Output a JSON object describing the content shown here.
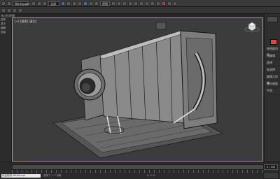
{
  "toolbar": {
    "workspace": "Workspace",
    "selection_filter": "全部",
    "view_select": "视图"
  },
  "ribbon": {
    "tab": "多边形建模"
  },
  "left_panel": {
    "items": [
      "选择",
      "显示",
      "编辑",
      "层级"
    ]
  },
  "viewport": {
    "label": "[+] [透视] [真实]"
  },
  "right_panel": {
    "items": [
      "修改器列表",
      "可编辑",
      "选择",
      "软选择",
      "编辑几何体",
      "细分曲面",
      "平滑"
    ]
  },
  "status": {
    "prompt": "欢迎使用 MAXScript",
    "text": "选择了 1 个对象",
    "coord": "X: Y: Z:",
    "frame": "0 / 100"
  }
}
